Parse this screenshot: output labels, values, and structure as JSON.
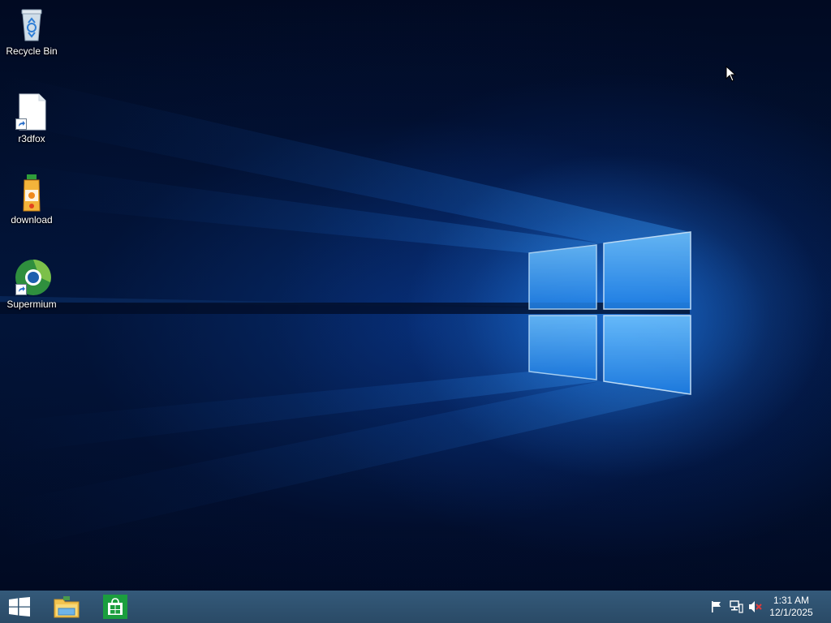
{
  "desktop": {
    "icons": [
      {
        "label": "Recycle Bin",
        "icon": "recycle-bin-icon"
      },
      {
        "label": "r3dfox",
        "icon": "blank-document-icon",
        "shortcut": true
      },
      {
        "label": "download",
        "icon": "juice-bottle-icon"
      },
      {
        "label": "Supermium",
        "icon": "browser-globe-icon",
        "shortcut": true
      }
    ]
  },
  "taskbar": {
    "start_icon": "windows-logo-icon",
    "pinned": [
      {
        "name": "File Explorer",
        "icon": "folder-icon"
      },
      {
        "name": "Store",
        "icon": "store-bag-icon"
      }
    ],
    "tray": {
      "icons": [
        "action-center-flag-icon",
        "network-icon",
        "volume-muted-icon"
      ],
      "time": "1:31 AM",
      "date": "12/1/2025"
    }
  },
  "colors": {
    "taskbar": "#2a4a66",
    "wallpaper_glow": "#1e8cff",
    "store_green": "#1b9e3e"
  }
}
